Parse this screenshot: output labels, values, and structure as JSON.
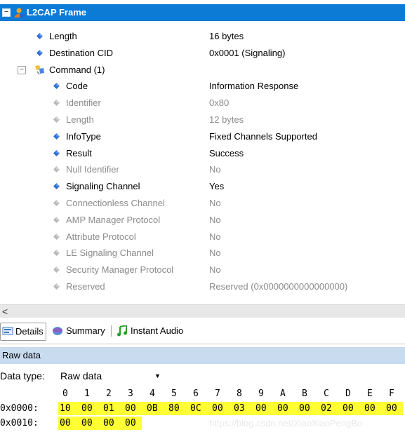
{
  "tree": {
    "frame_label": "L2CAP Frame",
    "rows": [
      {
        "name": "Length",
        "value": "16 bytes",
        "level": 1,
        "active": true
      },
      {
        "name": "Destination CID",
        "value": "0x0001 (Signaling)",
        "level": 1,
        "active": true
      },
      {
        "name": "Command (1)",
        "value": "",
        "level": 1,
        "group": true
      },
      {
        "name": "Code",
        "value": "Information Response",
        "level": 2,
        "active": true
      },
      {
        "name": "Identifier",
        "value": "0x80",
        "level": 2,
        "active": false
      },
      {
        "name": "Length",
        "value": "12 bytes",
        "level": 2,
        "active": false
      },
      {
        "name": "InfoType",
        "value": "Fixed Channels Supported",
        "level": 2,
        "active": true
      },
      {
        "name": "Result",
        "value": "Success",
        "level": 2,
        "active": true
      },
      {
        "name": "Null Identifier",
        "value": "No",
        "level": 2,
        "active": false
      },
      {
        "name": "Signaling Channel",
        "value": "Yes",
        "level": 2,
        "active": true
      },
      {
        "name": "Connectionless Channel",
        "value": "No",
        "level": 2,
        "active": false
      },
      {
        "name": "AMP Manager Protocol",
        "value": "No",
        "level": 2,
        "active": false
      },
      {
        "name": "Attribute Protocol",
        "value": "No",
        "level": 2,
        "active": false
      },
      {
        "name": "LE Signaling Channel",
        "value": "No",
        "level": 2,
        "active": false
      },
      {
        "name": "Security Manager Protocol",
        "value": "No",
        "level": 2,
        "active": false
      },
      {
        "name": "Reserved",
        "value": "Reserved (0x0000000000000000)",
        "level": 2,
        "active": false
      }
    ],
    "expander_collapse": "−"
  },
  "scroll": {
    "left_arrow": "<"
  },
  "tabs": {
    "details": "Details",
    "summary": "Summary",
    "audio": "Instant Audio"
  },
  "raw": {
    "header": "Raw data",
    "data_type_label": "Data type:",
    "data_type_value": "Raw data",
    "dropdown_arrow": "▼",
    "columns": [
      "0",
      "1",
      "2",
      "3",
      "4",
      "5",
      "6",
      "7",
      "8",
      "9",
      "A",
      "B",
      "C",
      "D",
      "E",
      "F"
    ],
    "rows": [
      {
        "address": "0x0000:",
        "bytes": [
          "10",
          "00",
          "01",
          "00",
          "0B",
          "80",
          "0C",
          "00",
          "03",
          "00",
          "00",
          "00",
          "02",
          "00",
          "00",
          "00"
        ]
      },
      {
        "address": "0x0010:",
        "bytes": [
          "00",
          "00",
          "00",
          "00"
        ]
      }
    ]
  },
  "watermark": "https://blog.csdn.net/XiaoXiaoPengBo"
}
